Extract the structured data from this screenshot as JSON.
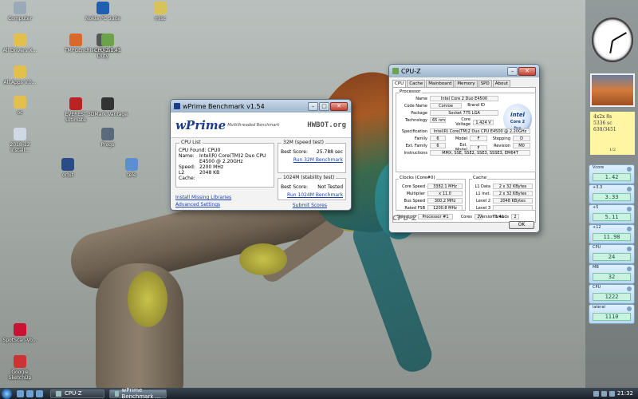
{
  "desktop_icons": [
    {
      "id": "computer",
      "label": "Computer",
      "color": "#9aa9b8"
    },
    {
      "id": "nokia",
      "label": "Nokia PC Suite",
      "color": "#1f5fb0"
    },
    {
      "id": "misc",
      "label": "misc",
      "color": "#d8c25a"
    },
    {
      "id": "folder1",
      "label": "All Drivers X...",
      "color": "#e3c04e"
    },
    {
      "id": "folder2",
      "label": "All.Apps V.0...",
      "color": "#e3c04e"
    },
    {
      "id": "folder3",
      "label": "oc",
      "color": "#e3c04e"
    },
    {
      "id": "install",
      "label": "2018-12 Install...",
      "color": "#cfd9e6"
    },
    {
      "id": "callofduty",
      "label": "Rise of Call of Duty",
      "color": "#555"
    },
    {
      "id": "everest",
      "label": "TMPGEnc",
      "color": "#d9682a"
    },
    {
      "id": "cpuz",
      "label": "CPU-Z 1.41",
      "color": "#6aa34a"
    },
    {
      "id": "everest2",
      "label": "EVEREST Ultimate",
      "color": "#b22"
    },
    {
      "id": "lapt",
      "label": "3DMark Vantage",
      "color": "#333"
    },
    {
      "id": "prog",
      "label": "Progs",
      "color": "#5a6a7a"
    },
    {
      "id": "orbit",
      "label": "orbit",
      "color": "#2a4d8a"
    },
    {
      "id": "tele",
      "label": "tele",
      "color": "#5b8fd0"
    },
    {
      "id": "spotted",
      "label": "SpotScan-Vo...",
      "color": "#c13"
    },
    {
      "id": "google",
      "label": "Google SketchUp",
      "color": "#c33"
    }
  ],
  "wprime": {
    "title": "wPrime Benchmark v1.54",
    "logo": "wPrime",
    "tagline": "Multithreaded Benchmark",
    "hwbot": "HWBOT.org",
    "cpu_list_title": "CPU List",
    "cpu_found": "CPU Found: CPU0",
    "cpu_rows": [
      {
        "k": "Name:",
        "v": "Intel(R) Core(TM)2 Duo CPU"
      },
      {
        "k": "",
        "v": "E4500 @ 2.20GHz"
      },
      {
        "k": "Speed:",
        "v": "2200 MHz"
      },
      {
        "k": "L2 Cache:",
        "v": "2048 KB"
      }
    ],
    "test32_title": "32M (speed test)",
    "test32_label": "Best Score:",
    "test32_value": "25.788 sec",
    "test32_link": "Run 32M Benchmark",
    "test1024_title": "1024M (stability test)",
    "test1024_label": "Best Score:",
    "test1024_value": "Not Tested",
    "test1024_link": "Run 1024M Benchmark",
    "link_install": "Install Missing Libraries",
    "link_advanced": "Advanced Settings",
    "submit": "Submit Scores"
  },
  "cpuz": {
    "title": "CPU-Z",
    "tabs": [
      "CPU",
      "Cache",
      "Mainboard",
      "Memory",
      "SPD",
      "About"
    ],
    "processor_title": "Processor",
    "name_lbl": "Name",
    "name": "Intel Core 2 Duo E4500",
    "codename_lbl": "Code Name",
    "codename": "Conroe",
    "brand_lbl": "Brand ID",
    "package_lbl": "Package",
    "package": "Socket 775 LGA",
    "tech_lbl": "Technology",
    "tech": "65 nm",
    "voltage_lbl": "Core Voltage",
    "voltage": "1.424 V",
    "spec_lbl": "Specification",
    "spec": "Intel(R) Core(TM)2 Duo CPU      E4500 @ 2.20GHz",
    "family_lbl": "Family",
    "family": "6",
    "model_lbl": "Model",
    "model": "F",
    "stepping_lbl": "Stepping",
    "stepping": "D",
    "extfamily_lbl": "Ext. Family",
    "extfamily": "6",
    "extmodel_lbl": "Ext. Model",
    "extmodel": "F",
    "revision_lbl": "Revision",
    "revision": "M0",
    "instr_lbl": "Instructions",
    "instr": "MMX, SSE, SSE2, SSE3, SSSE3, EM64T",
    "intel_brand": "intel",
    "intel_product": "Core 2",
    "intel_sub": "Duo",
    "clocks_title": "Clocks (Core#0)",
    "corespeed_lbl": "Core Speed",
    "corespeed": "3382.1 MHz",
    "mult_lbl": "Multiplier",
    "mult": "x 11.0",
    "bus_lbl": "Bus Speed",
    "bus": "300.2 MHz",
    "fsb_lbl": "Rated FSB",
    "fsb": "1200.8 MHz",
    "cache_title": "Cache",
    "l1d_lbl": "L1 Data",
    "l1d": "2 x 32 KBytes",
    "l1i_lbl": "L1 Inst.",
    "l1i": "2 x 32 KBytes",
    "l2_lbl": "Level 2",
    "l2": "2048 KBytes",
    "l3_lbl": "Level 3",
    "l3": "",
    "selection_lbl": "Selection",
    "selection": "Processor #1",
    "cores_lbl": "Cores",
    "cores": "2",
    "threads_lbl": "Threads",
    "threads": "2",
    "version": "Version 1.41",
    "logo": "CPU-Z",
    "ok": "OK"
  },
  "sidebar": {
    "note_lines": [
      "4x2x 8s",
      "5336 sc",
      "630/3451"
    ],
    "note_nav": "1/2",
    "meters": [
      {
        "label": "Vcore",
        "value": "1.42"
      },
      {
        "label": "+3.3",
        "value": "3.33"
      },
      {
        "label": "+5",
        "value": "5.11"
      },
      {
        "label": "+12",
        "value": "11.98"
      },
      {
        "label": "CPU",
        "value": "24"
      },
      {
        "label": "MB",
        "value": "32"
      },
      {
        "label": "CPU",
        "value": "1222"
      },
      {
        "label": "lateral",
        "value": "1110"
      }
    ]
  },
  "taskbar": {
    "tasks": [
      {
        "label": "CPU-Z"
      },
      {
        "label": "wPrime Benchmark ..."
      }
    ],
    "clock": "21:32"
  }
}
